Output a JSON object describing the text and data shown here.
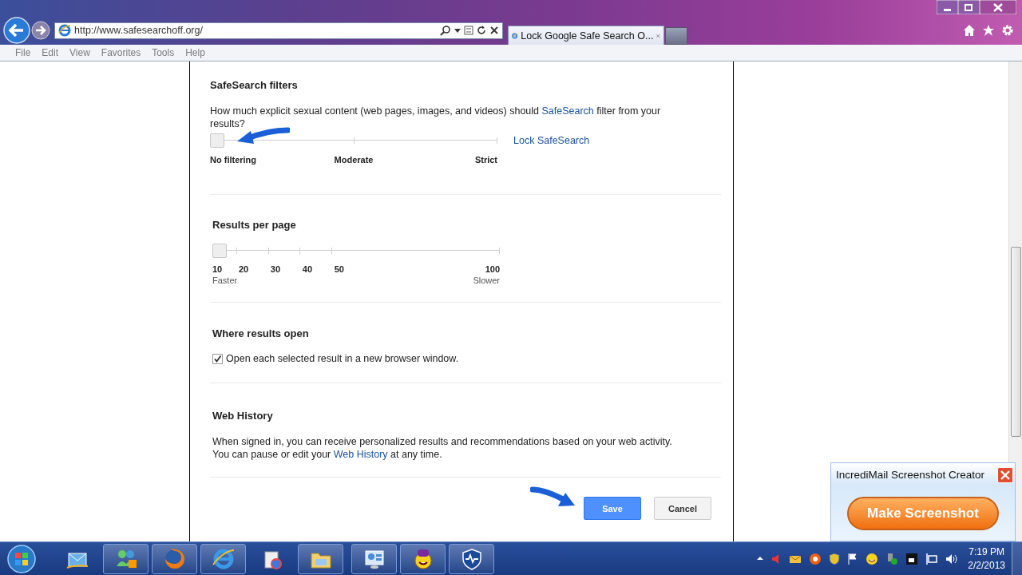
{
  "browser": {
    "address": "http://www.safesearchoff.org/",
    "tab_title": "Lock Google Safe Search O...",
    "menu": [
      "File",
      "Edit",
      "View",
      "Favorites",
      "Tools",
      "Help"
    ]
  },
  "safesearch": {
    "title": "SafeSearch filters",
    "question_before": "How much explicit sexual content (web pages, images, and videos) should ",
    "question_link": "SafeSearch",
    "question_after": " filter from your results?",
    "level": 0,
    "stops": [
      "No filtering",
      "Moderate",
      "Strict"
    ],
    "lock_link": "Lock SafeSearch"
  },
  "results_per_page": {
    "title": "Results per page",
    "level": 0,
    "stops": [
      "10",
      "20",
      "30",
      "40",
      "50",
      "100"
    ],
    "low_note": "Faster",
    "high_note": "Slower"
  },
  "where_results_open": {
    "title": "Where results open",
    "checkbox": {
      "label": "Open each selected result in a new browser window.",
      "checked": true
    }
  },
  "web_history": {
    "title": "Web History",
    "line_1": "When signed in, you can receive personalized results and recommendations based on your web activity.",
    "line_2_before": "You can pause or edit your ",
    "line_2_link": "Web History",
    "line_2_after": " at any time."
  },
  "buttons": {
    "save": "Save",
    "cancel": "Cancel"
  },
  "popup": {
    "title": "IncrediMail Screenshot Creator",
    "button": "Make Screenshot"
  },
  "taskbar": {
    "time": "7:19 PM",
    "date": "2/2/2013"
  }
}
